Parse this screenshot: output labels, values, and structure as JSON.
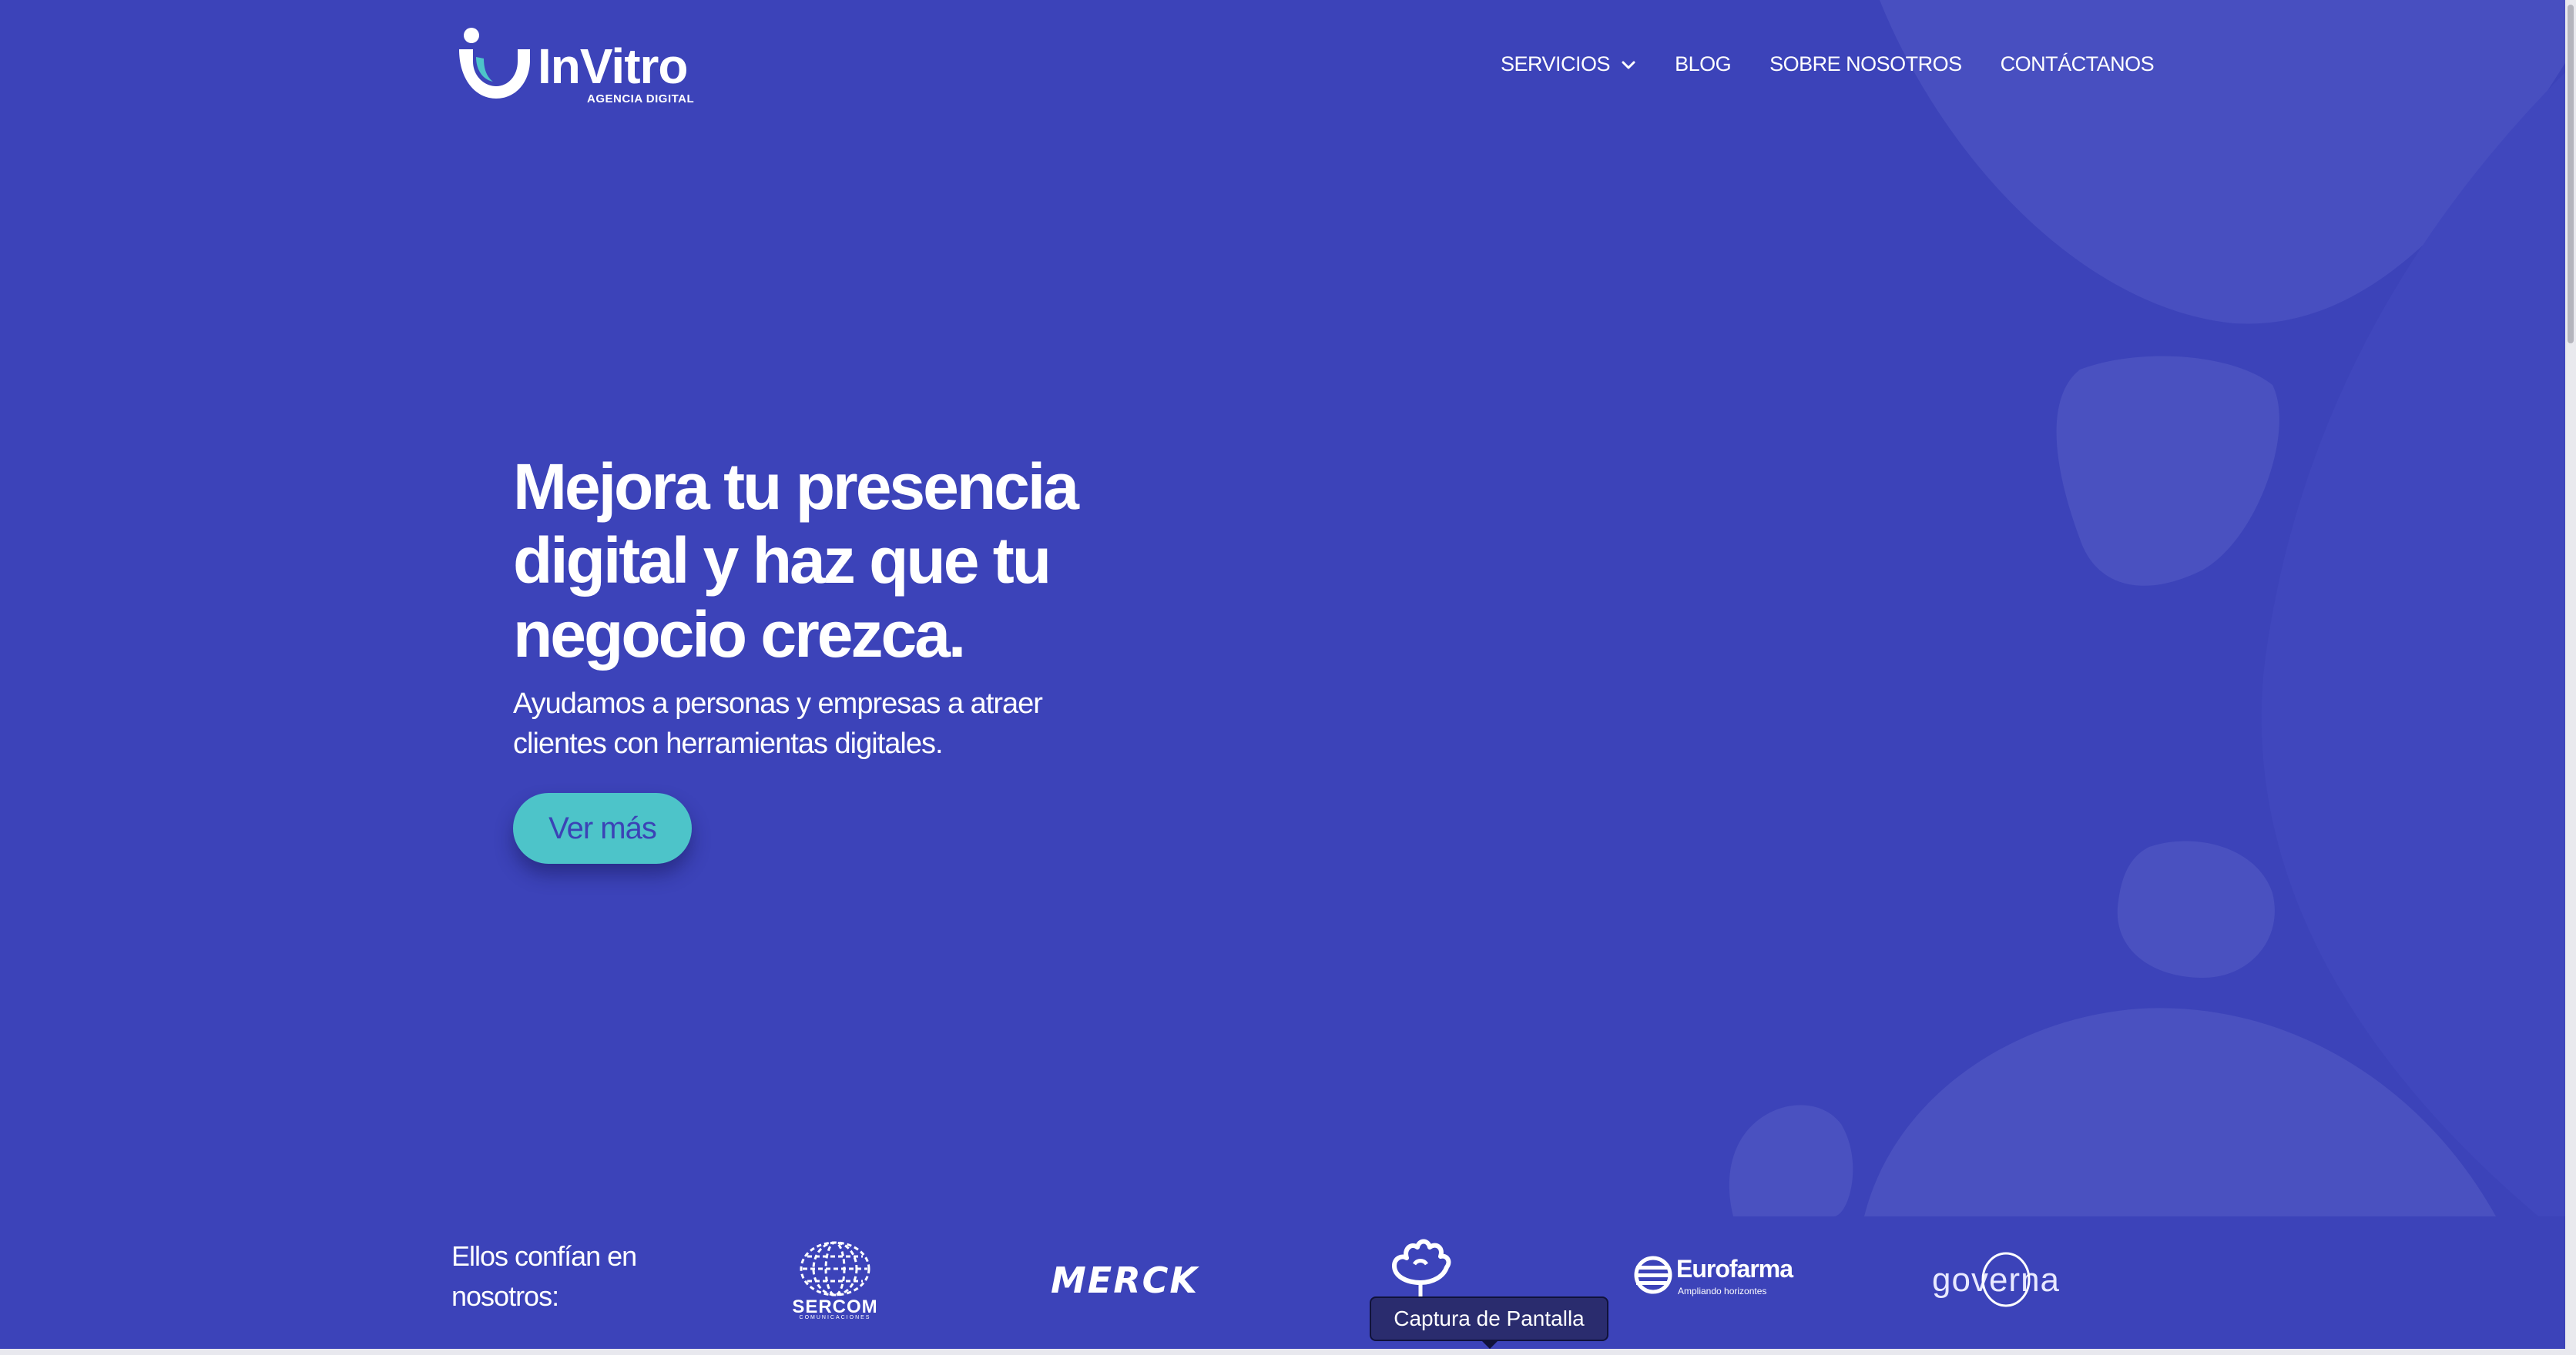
{
  "brand": {
    "name": "InVitro",
    "tagline": "AGENCIA DIGITAL",
    "icon": "invitro-logo-mark"
  },
  "nav": {
    "items": [
      {
        "label": "SERVICIOS",
        "has_dropdown": true,
        "icon": "chevron-down-icon"
      },
      {
        "label": "BLOG"
      },
      {
        "label": "SOBRE NOSOTROS"
      },
      {
        "label": "CONTÁCTANOS"
      }
    ]
  },
  "hero": {
    "title": "Mejora tu presencia digital y haz que tu negocio crezca.",
    "subtitle": "Ayudamos a personas y empresas a atraer clientes con herramientas digitales.",
    "cta_label": "Ver más"
  },
  "trust": {
    "label": "Ellos confían en nosotros:",
    "clients": [
      {
        "name": "SERCOM",
        "sub": "COMUNICACIONES",
        "icon": "sercom-globe-logo"
      },
      {
        "name": "MERCK",
        "icon": "merck-logo"
      },
      {
        "name": "",
        "icon": "flower-logo"
      },
      {
        "name": "Eurofarma",
        "sub": "Ampliando horizontes",
        "icon": "eurofarma-globe-logo"
      },
      {
        "name": "governa",
        "icon": "governa-logo"
      }
    ]
  },
  "tooltip": {
    "text": "Captura de Pantalla"
  },
  "colors": {
    "background": "#3c43b9",
    "blob": "#4a51c0",
    "cta_bg": "#4dc4c9",
    "cta_text": "#3b43b6",
    "text": "#ffffff"
  }
}
